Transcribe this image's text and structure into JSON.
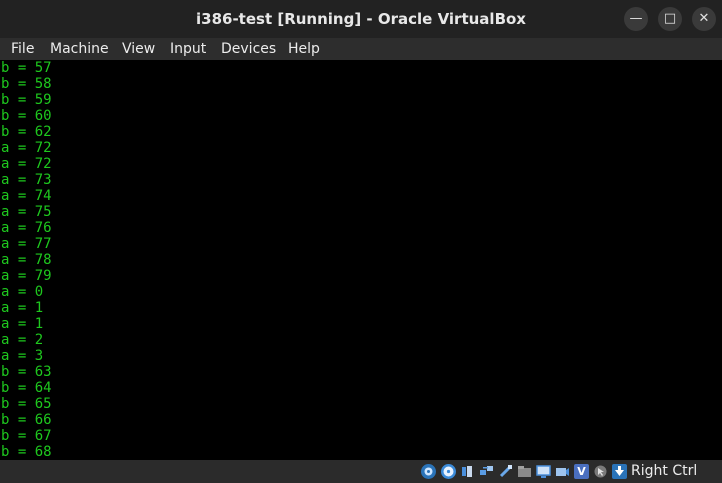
{
  "window": {
    "title": "i386-test [Running] - Oracle VirtualBox"
  },
  "controls": {
    "minimize": "—",
    "maximize": "□",
    "close": "✕"
  },
  "menu": [
    "File",
    "Machine",
    "View",
    "Input",
    "Devices",
    "Help"
  ],
  "console": {
    "text_color": "#1ec81e",
    "lines": [
      "b = 57",
      "b = 58",
      "b = 59",
      "b = 60",
      "b = 62",
      "a = 72",
      "a = 72",
      "a = 73",
      "a = 74",
      "a = 75",
      "a = 76",
      "a = 77",
      "a = 78",
      "a = 79",
      "a = 0",
      "a = 1",
      "a = 1",
      "a = 2",
      "a = 3",
      "b = 63",
      "b = 64",
      "b = 65",
      "b = 66",
      "b = 67",
      "b = 68"
    ]
  },
  "statusbar": {
    "icons": [
      "hard-disk-icon",
      "optical-disk-icon",
      "audio-icon",
      "network-icon",
      "usb-icon",
      "shared-folders-icon",
      "display-icon",
      "recording-icon",
      "virtualization-icon",
      "mouse-integration-icon",
      "keyboard-icon"
    ],
    "host_key": "Right Ctrl"
  }
}
